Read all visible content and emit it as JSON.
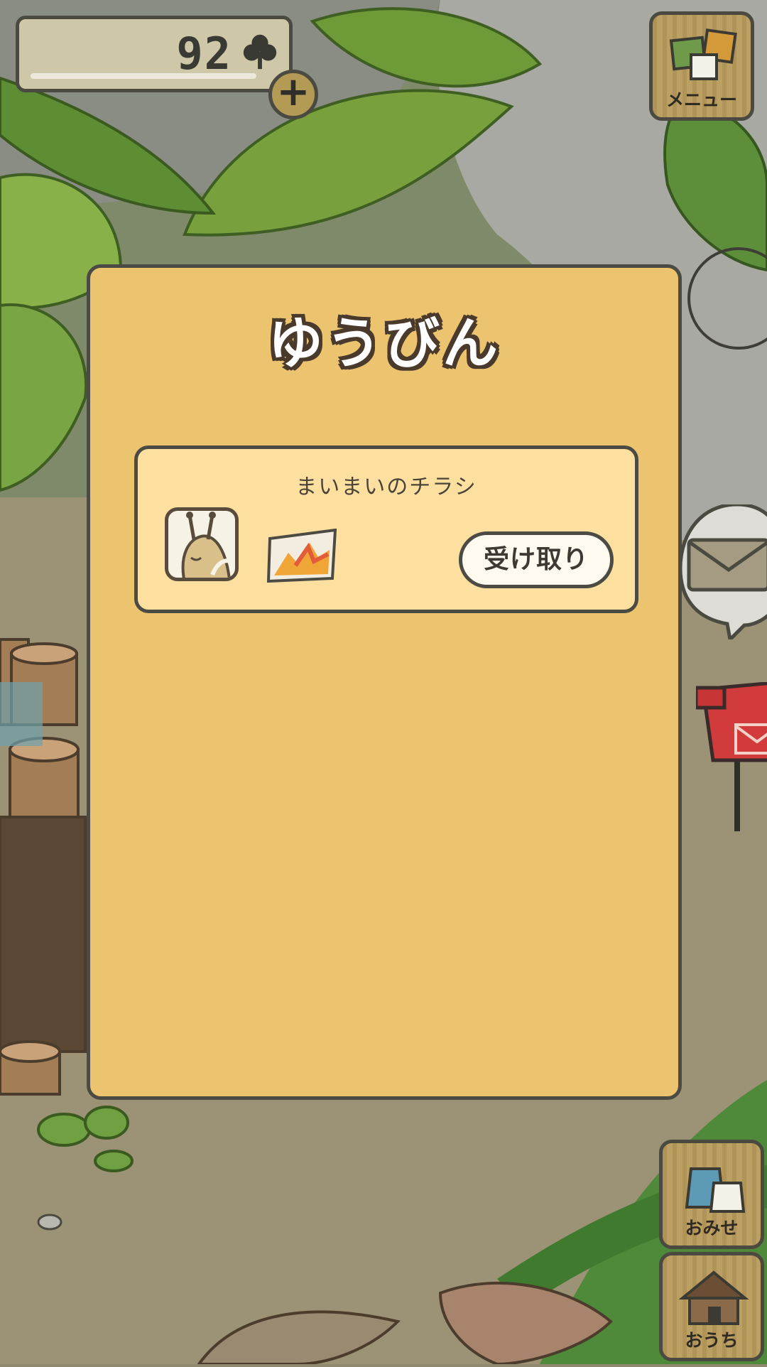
{
  "hud": {
    "clover_count": "92",
    "clover_icon": "clover-icon",
    "add_icon": "plus-icon"
  },
  "side_buttons": {
    "menu_label": "メニュー",
    "shop_label": "おみせ",
    "home_label": "おうち"
  },
  "mail_dialog": {
    "title": "ゆうびん",
    "items": [
      {
        "name": "まいまいのチラシ",
        "sender_icon": "snail-avatar-icon",
        "item_icon": "flyer-icon",
        "receive_label": "受け取り"
      }
    ]
  },
  "colors": {
    "dialog_bg": "#ecc470",
    "item_bg": "#fde09f",
    "outline": "#4b4b43"
  }
}
